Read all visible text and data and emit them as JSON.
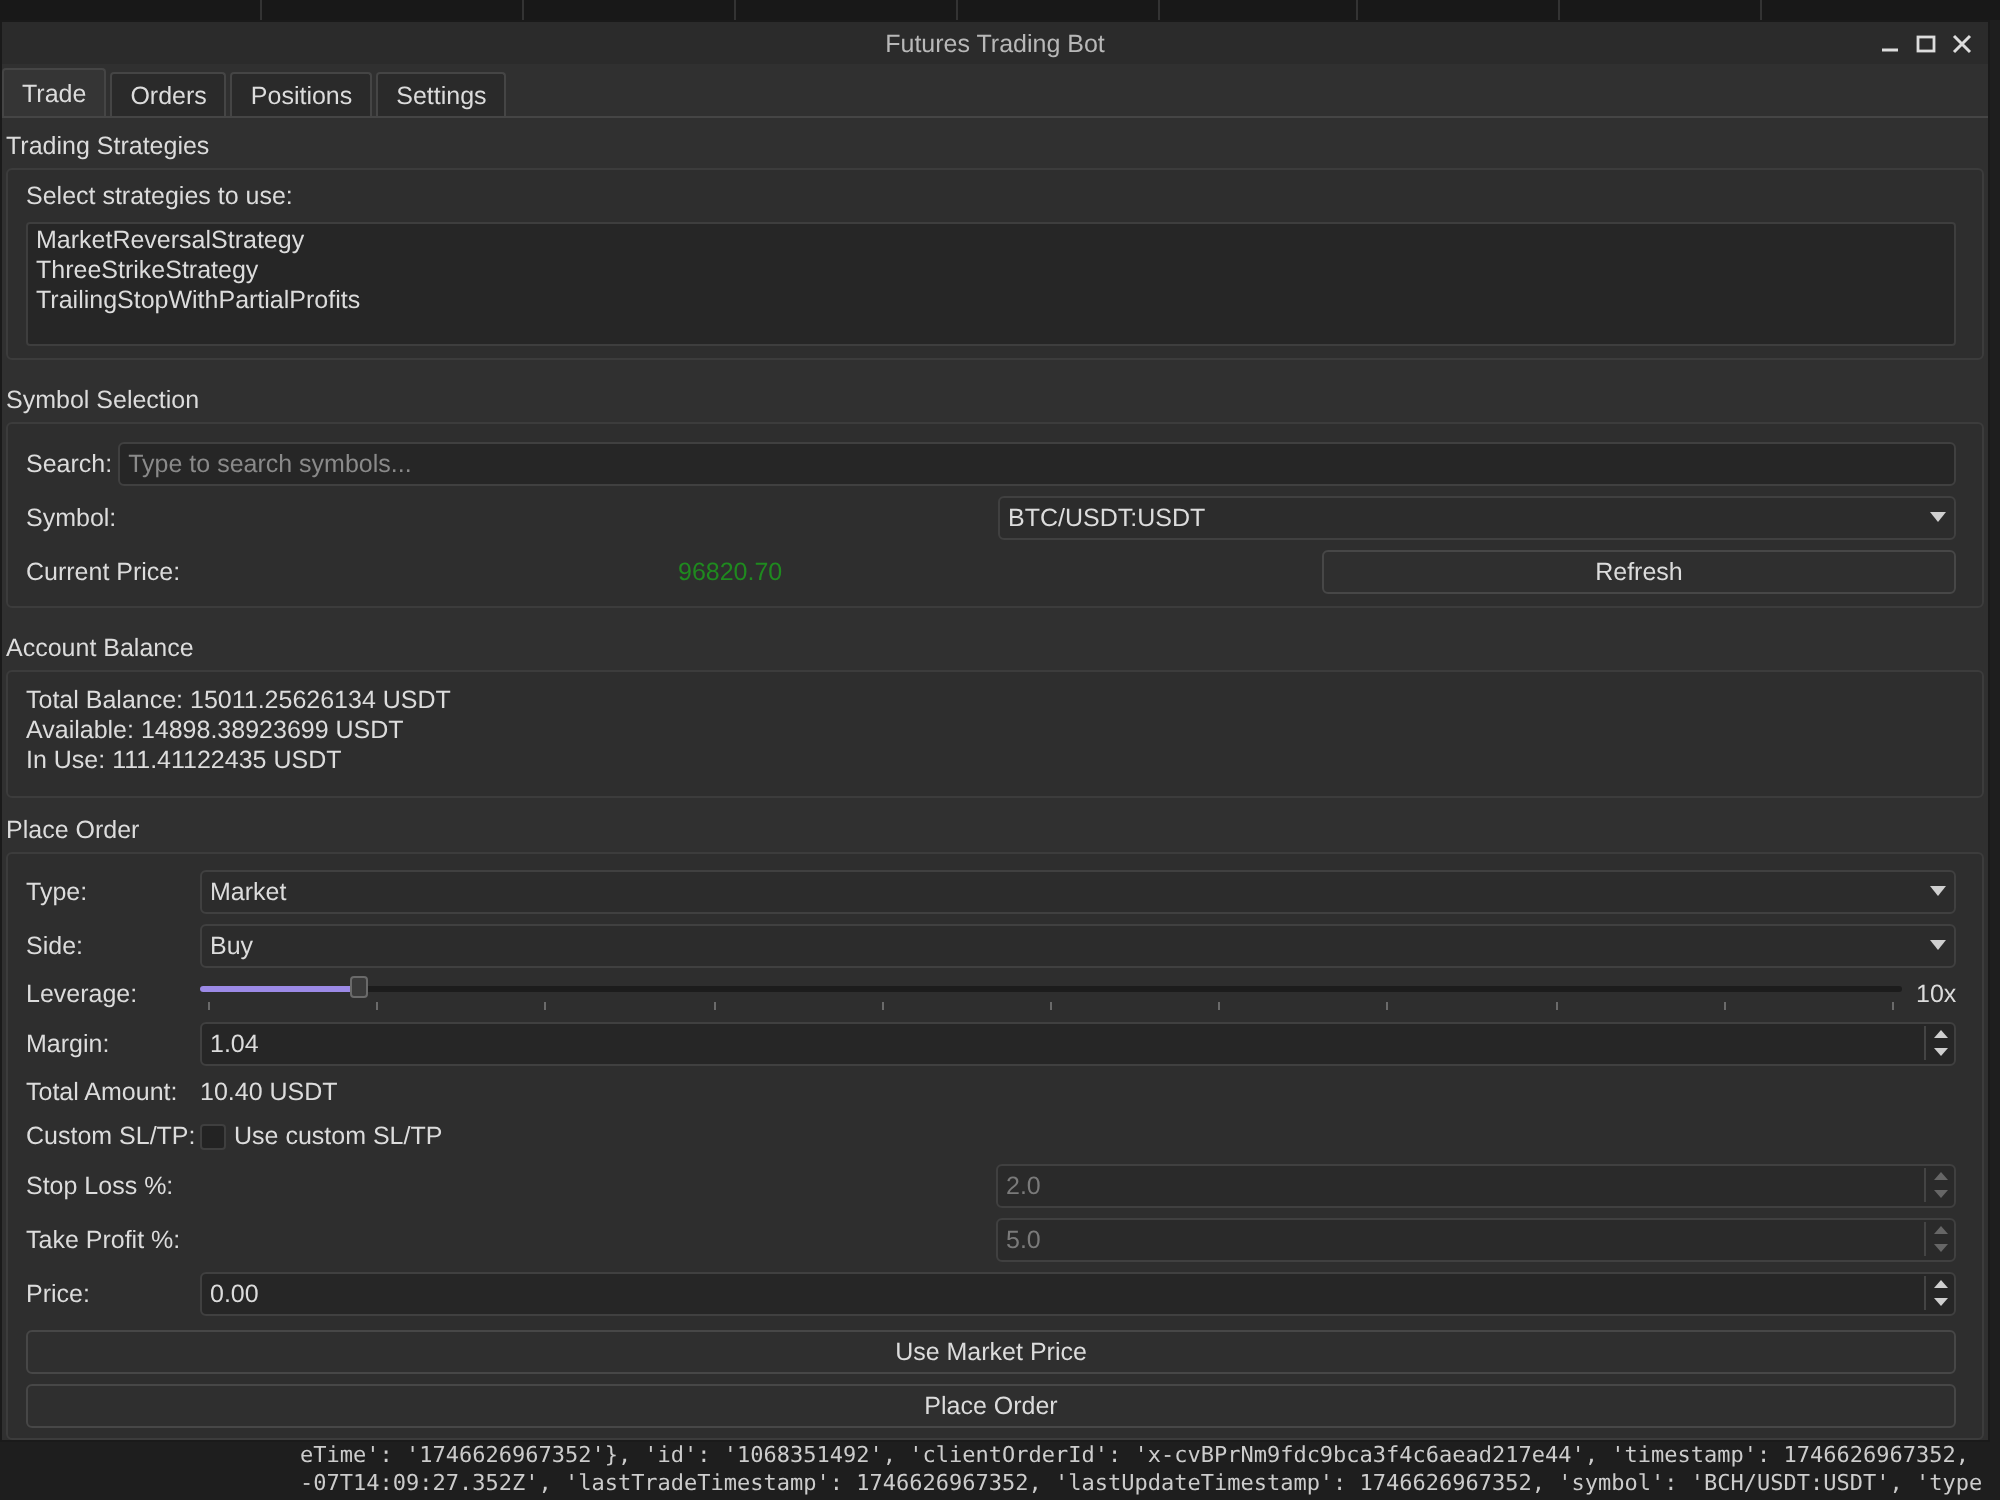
{
  "window": {
    "title": "Futures Trading Bot"
  },
  "tabs": [
    {
      "label": "Trade",
      "selected": true
    },
    {
      "label": "Orders",
      "selected": false
    },
    {
      "label": "Positions",
      "selected": false
    },
    {
      "label": "Settings",
      "selected": false
    }
  ],
  "strategies": {
    "title": "Trading Strategies",
    "prompt": "Select strategies to use:",
    "items": [
      {
        "label": "MarketReversalStrategy",
        "selected": false
      },
      {
        "label": "ThreeStrikeStrategy",
        "selected": false
      },
      {
        "label": "TrailingStopWithPartialProfits",
        "selected": false
      }
    ]
  },
  "symbol_selection": {
    "title": "Symbol Selection",
    "search_label": "Search:",
    "search_placeholder": "Type to search symbols...",
    "symbol_label": "Symbol:",
    "symbol_value": "BTC/USDT:USDT",
    "price_label": "Current Price:",
    "price_value": "96820.70",
    "refresh_button": "Refresh"
  },
  "account_balance": {
    "title": "Account Balance",
    "lines": [
      "Total Balance: 15011.25626134 USDT",
      "Available: 14898.38923699 USDT",
      "In Use: 111.41122435 USDT"
    ]
  },
  "place_order": {
    "title": "Place Order",
    "rows": [
      {
        "kind": "combo",
        "label": "Type:",
        "value": "Market"
      },
      {
        "kind": "combo",
        "label": "Side:",
        "value": "Buy"
      },
      {
        "kind": "slider",
        "label": "Leverage:",
        "level": 0.094,
        "reading": "10x"
      },
      {
        "kind": "spin",
        "label": "Margin:",
        "value": "1.04",
        "disabled": false
      },
      {
        "kind": "text",
        "label": "Total Amount:",
        "value": "10.40 USDT"
      },
      {
        "kind": "checkbox",
        "label": "Custom SL/TP:",
        "text": "Use custom SL/TP",
        "checked": false
      },
      {
        "kind": "spin",
        "label": "Stop Loss %:",
        "value": "2.0",
        "disabled": true
      },
      {
        "kind": "spin",
        "label": "Take Profit %:",
        "value": "5.0",
        "disabled": true
      },
      {
        "kind": "spin",
        "label": "Price:",
        "value": "0.00",
        "disabled": false
      }
    ],
    "buttons": [
      "Use Market Price",
      "Place Order"
    ]
  },
  "terminal": {
    "lines": [
      "eTime': '1746626967352'}, 'id': '1068351492', 'clientOrderId': 'x-cvBPrNm9fdc9bca3f4c6aead217e44', 'timestamp': 1746626967352,",
      "-07T14:09:27.352Z', 'lastTradeTimestamp': 1746626967352, 'lastUpdateTimestamp': 1746626967352, 'symbol': 'BCH/USDT:USDT', 'type"
    ]
  }
}
